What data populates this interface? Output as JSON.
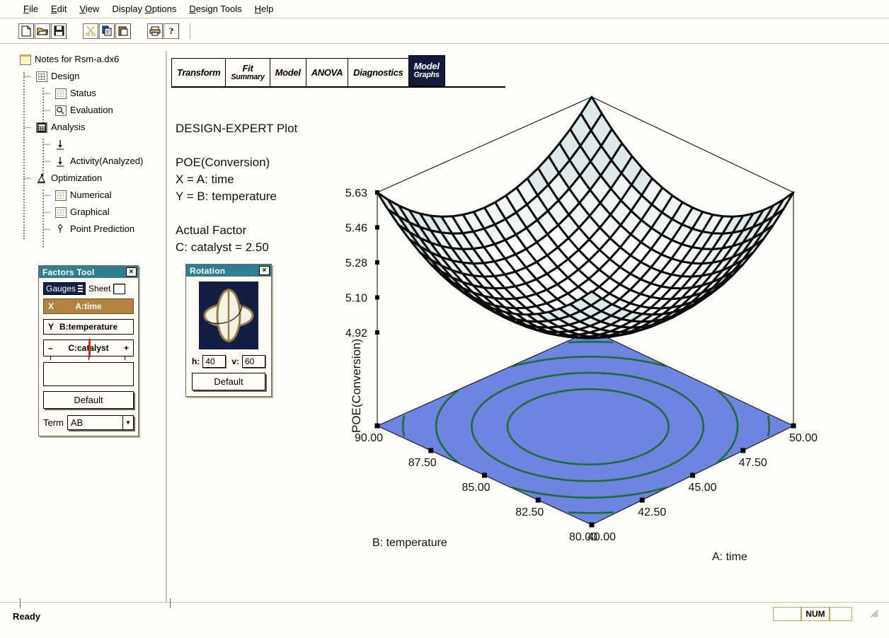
{
  "app": {
    "status_left": "Ready",
    "status_num": "NUM"
  },
  "menu": {
    "items": [
      {
        "label": "File",
        "accel": "F"
      },
      {
        "label": "Edit",
        "accel": "E"
      },
      {
        "label": "View",
        "accel": "V"
      },
      {
        "label": "Display Options",
        "accel": "O"
      },
      {
        "label": "Design Tools",
        "accel": "D"
      },
      {
        "label": "Help",
        "accel": "H"
      }
    ]
  },
  "toolbar": {
    "buttons": [
      {
        "name": "new-file-icon",
        "title": "New"
      },
      {
        "name": "open-folder-icon",
        "title": "Open"
      },
      {
        "name": "save-disk-icon",
        "title": "Save"
      },
      {
        "name": "cut-scissors-icon",
        "title": "Cut"
      },
      {
        "name": "copy-icon",
        "title": "Copy"
      },
      {
        "name": "paste-icon",
        "title": "Paste"
      },
      {
        "name": "print-icon",
        "title": "Print"
      },
      {
        "name": "help-question-icon",
        "title": "Help"
      }
    ]
  },
  "tree": {
    "root": "Notes for Rsm-a.dx6",
    "items": [
      {
        "label": "Design",
        "icon": "grid-icon",
        "level": 1
      },
      {
        "label": "Status",
        "icon": "grid-light-icon",
        "level": 2
      },
      {
        "label": "Evaluation",
        "icon": "magnifier-icon",
        "level": 2
      },
      {
        "label": "Analysis",
        "icon": "calculator-icon",
        "level": 1
      },
      {
        "label": "",
        "icon": "arrow-down-icon",
        "level": 2
      },
      {
        "label": "Activity(Analyzed)",
        "icon": "arrow-down-icon",
        "level": 2
      },
      {
        "label": "Optimization",
        "icon": "optimize-icon",
        "level": 1
      },
      {
        "label": "Numerical",
        "icon": "grid-light-icon",
        "level": 2
      },
      {
        "label": "Graphical",
        "icon": "grid-light-icon",
        "level": 2
      },
      {
        "label": "Point Prediction",
        "icon": "y-hat-icon",
        "level": 2
      }
    ]
  },
  "factors_tool": {
    "title": "Factors Tool",
    "close": "×",
    "gauges_label": "Gauges",
    "sheet_label": "Sheet",
    "factors": [
      {
        "axis": "X",
        "name": "A:time",
        "state": "active"
      },
      {
        "axis": "Y",
        "name": "B:temperature",
        "state": "plain"
      }
    ],
    "slider": {
      "minus": "–",
      "name": "C:catalyst",
      "plus": "+"
    },
    "default_label": "Default",
    "term_label": "Term",
    "term_value": "AB"
  },
  "rotation": {
    "title": "Rotation",
    "close": "×",
    "h_label": "h:",
    "h_value": "40",
    "v_label": "v:",
    "v_value": "60",
    "default_label": "Default"
  },
  "tabs": [
    {
      "label": "Transform",
      "active": false
    },
    {
      "label": "Fit",
      "label2": "Summary",
      "active": false
    },
    {
      "label": "Model",
      "active": false
    },
    {
      "label": "ANOVA",
      "active": false
    },
    {
      "label": "Diagnostics",
      "active": false
    },
    {
      "label": "Model",
      "label2": "Graphs",
      "active": true
    }
  ],
  "plot_header": {
    "line1": "DESIGN-EXPERT Plot",
    "line2": "POE(Conversion)",
    "line3": "X = A: time",
    "line4": "Y = B: temperature",
    "line5": "Actual Factor",
    "line6": "C: catalyst = 2.50"
  },
  "colors": {
    "base_plane": "#6d85e0",
    "contour": "#1f6b34",
    "title_bar": "#2f7f90",
    "factor_active": "#b3823f",
    "tab_active": "#121b3c",
    "mesh_line": "#0a0a0a",
    "mesh_fill_high": "#dde9ea",
    "mesh_fill_low": "#ffffff"
  },
  "chart_data": {
    "type": "surface",
    "title": "DESIGN-EXPERT Plot",
    "response": "POE(Conversion)",
    "xlabel": "A: time",
    "ylabel": "B: temperature",
    "zlabel": "POE(Conversion)",
    "x_ticks": [
      "40.00",
      "42.50",
      "45.00",
      "47.50",
      "50.00"
    ],
    "y_ticks": [
      "80.00",
      "82.50",
      "85.00",
      "87.50",
      "90.00"
    ],
    "z_ticks": [
      "4.92",
      "5.10",
      "5.28",
      "5.46",
      "5.63"
    ],
    "xlim": [
      40.0,
      50.0
    ],
    "ylim": [
      80.0,
      90.0
    ],
    "zlim": [
      4.92,
      5.63
    ],
    "actual_factor": "C: catalyst = 2.50",
    "rotation_h": 40,
    "rotation_v": 60,
    "grid_cells": 20,
    "surface_shape": "convex-bowl (minimum near center)",
    "contour_levels": 4,
    "contour_color": "#1f6b34",
    "base_plane_color": "#6d85e0",
    "legend": "none",
    "grid": true
  }
}
